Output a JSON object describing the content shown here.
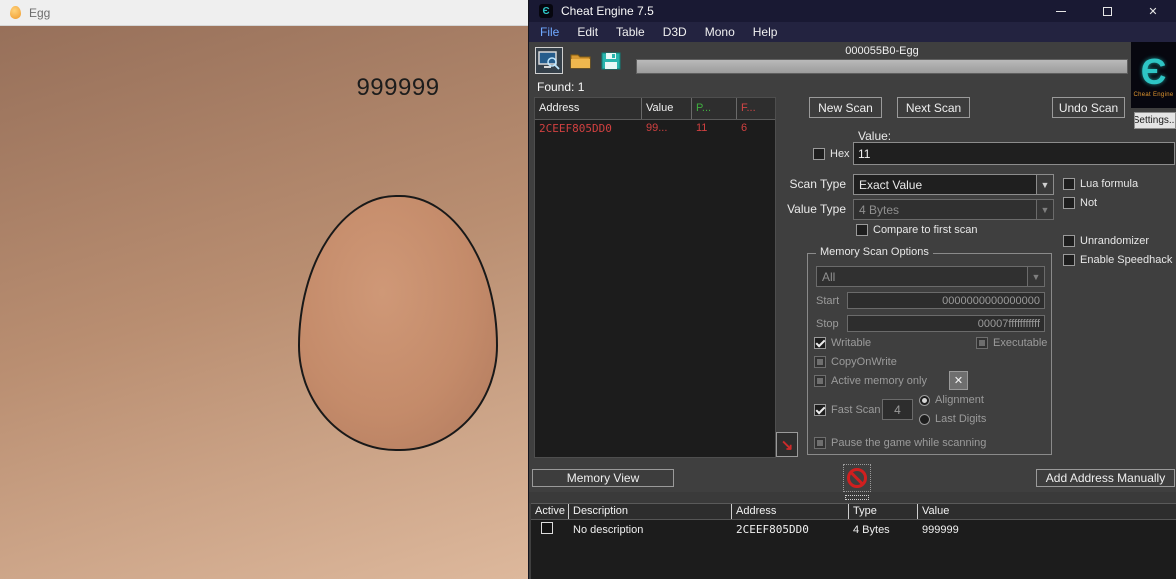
{
  "palette": {
    "titlebar_navy": "#191933",
    "window_gray": "#3f3f3f",
    "value_red": "#d04040",
    "prev_green": "#3fae3f",
    "logo_teal": "#2ec5c5",
    "noentry_red": "#d01f1f"
  },
  "game": {
    "title": "Egg",
    "score": "999999"
  },
  "ce": {
    "window_title": "Cheat Engine 7.5",
    "menu": [
      "File",
      "Edit",
      "Table",
      "D3D",
      "Mono",
      "Help"
    ],
    "process_label": "000055B0-Egg",
    "found_label": "Found: 1",
    "logo_glyph": "Є",
    "logo_caption": "Cheat Engine",
    "settings_button": "Settings...",
    "buttons": {
      "new_scan": "New Scan",
      "next_scan": "Next Scan",
      "undo_scan": "Undo Scan",
      "memory_view": "Memory View",
      "add_address": "Add Address Manually"
    },
    "scan": {
      "value_label": "Value:",
      "hex_label": "Hex",
      "value": "11",
      "scan_type_label": "Scan Type",
      "scan_type": "Exact Value",
      "value_type_label": "Value Type",
      "value_type": "4 Bytes",
      "compare_label": "Compare to first scan",
      "lua_label": "Lua formula",
      "not_label": "Not",
      "unrandomizer_label": "Unrandomizer",
      "speedhack_label": "Enable Speedhack"
    },
    "memscan": {
      "title": "Memory Scan Options",
      "region": "All",
      "start_label": "Start",
      "start": "0000000000000000",
      "stop_label": "Stop",
      "stop": "00007fffffffffff",
      "writable": "Writable",
      "executable": "Executable",
      "copy_on_write": "CopyOnWrite",
      "active_memory": "Active memory only",
      "fast_scan": "Fast Scan",
      "alignment_value": "4",
      "alignment": "Alignment",
      "last_digits": "Last Digits",
      "pause": "Pause the game while scanning"
    },
    "found_table": {
      "h_address": "Address",
      "h_value": "Value",
      "h_previous": "P...",
      "h_first": "F...",
      "row": {
        "address": "2CEEF805DD0",
        "value": "99...",
        "previous": "11",
        "first": "6"
      }
    },
    "address_list": {
      "h_active": "Active",
      "h_description": "Description",
      "h_address": "Address",
      "h_type": "Type",
      "h_value": "Value",
      "row": {
        "description": "No description",
        "address": "2CEEF805DD0",
        "type": "4 Bytes",
        "value": "999999"
      }
    }
  }
}
